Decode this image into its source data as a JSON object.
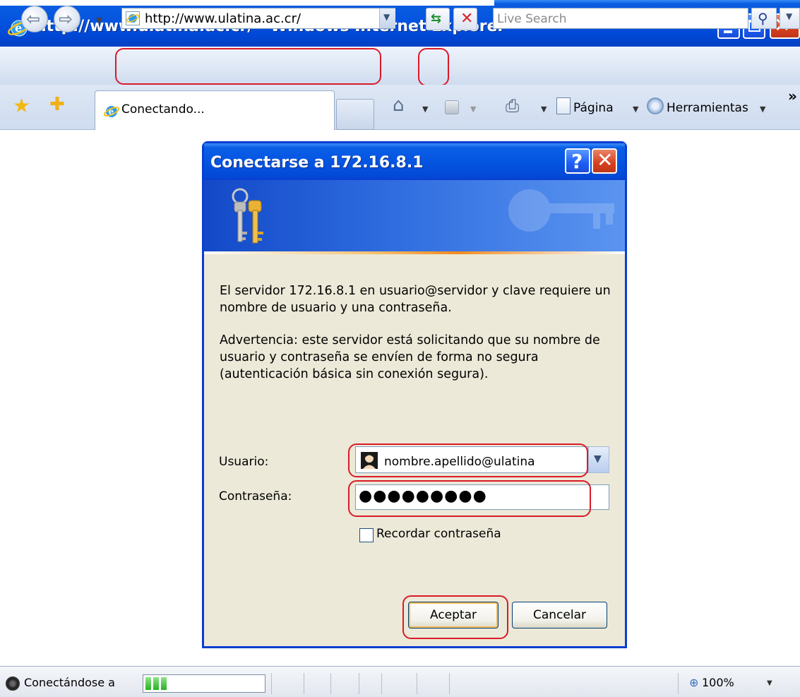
{
  "window": {
    "title": "http://www.ulatina.ac.cr/ - Windows Internet Explorer"
  },
  "navbar": {
    "address": "http://www.ulatina.ac.cr/",
    "search_placeholder": "Live Search"
  },
  "tabs": {
    "active_label": "Conectando..."
  },
  "commandbar": {
    "page_label": "Página",
    "tools_label": "Herramientas"
  },
  "dialog": {
    "title": "Conectarse a 172.16.8.1",
    "message_1": "El servidor 172.16.8.1 en usuario@servidor y clave requiere un nombre de usuario y una contraseña.",
    "message_2": "Advertencia: este servidor está solicitando que su nombre de usuario y contraseña se envíen de forma no segura (autenticación básica sin conexión segura).",
    "user_label": "Usuario:",
    "user_value": "nombre.apellido@ulatina",
    "password_label": "Contraseña:",
    "password_value": "●●●●●●●●●",
    "remember_label": "Recordar contraseña",
    "remember_checked": false,
    "accept_label": "Aceptar",
    "cancel_label": "Cancelar"
  },
  "statusbar": {
    "status_text": "Conectándose a",
    "progress_fraction": 0.18,
    "zoom": "100%"
  },
  "icons": {
    "title": "ie-logo-icon",
    "back": "back-arrow-icon",
    "forward": "forward-arrow-icon",
    "refresh": "refresh-icon",
    "stop": "stop-icon",
    "search": "search-icon",
    "favorites": "favorites-star-icon",
    "add_favorite": "add-favorite-icon",
    "home": "home-icon",
    "feeds": "feeds-icon",
    "print": "print-icon",
    "page": "page-icon",
    "tools": "gear-icon",
    "keys": "keys-icon",
    "user": "user-avatar-icon",
    "zoom": "zoom-icon"
  },
  "colors": {
    "title_bar_blue": "#0554e0",
    "dialog_body": "#ece9d8",
    "annotation_red": "#d91a28",
    "progress_green": "#27b022"
  }
}
